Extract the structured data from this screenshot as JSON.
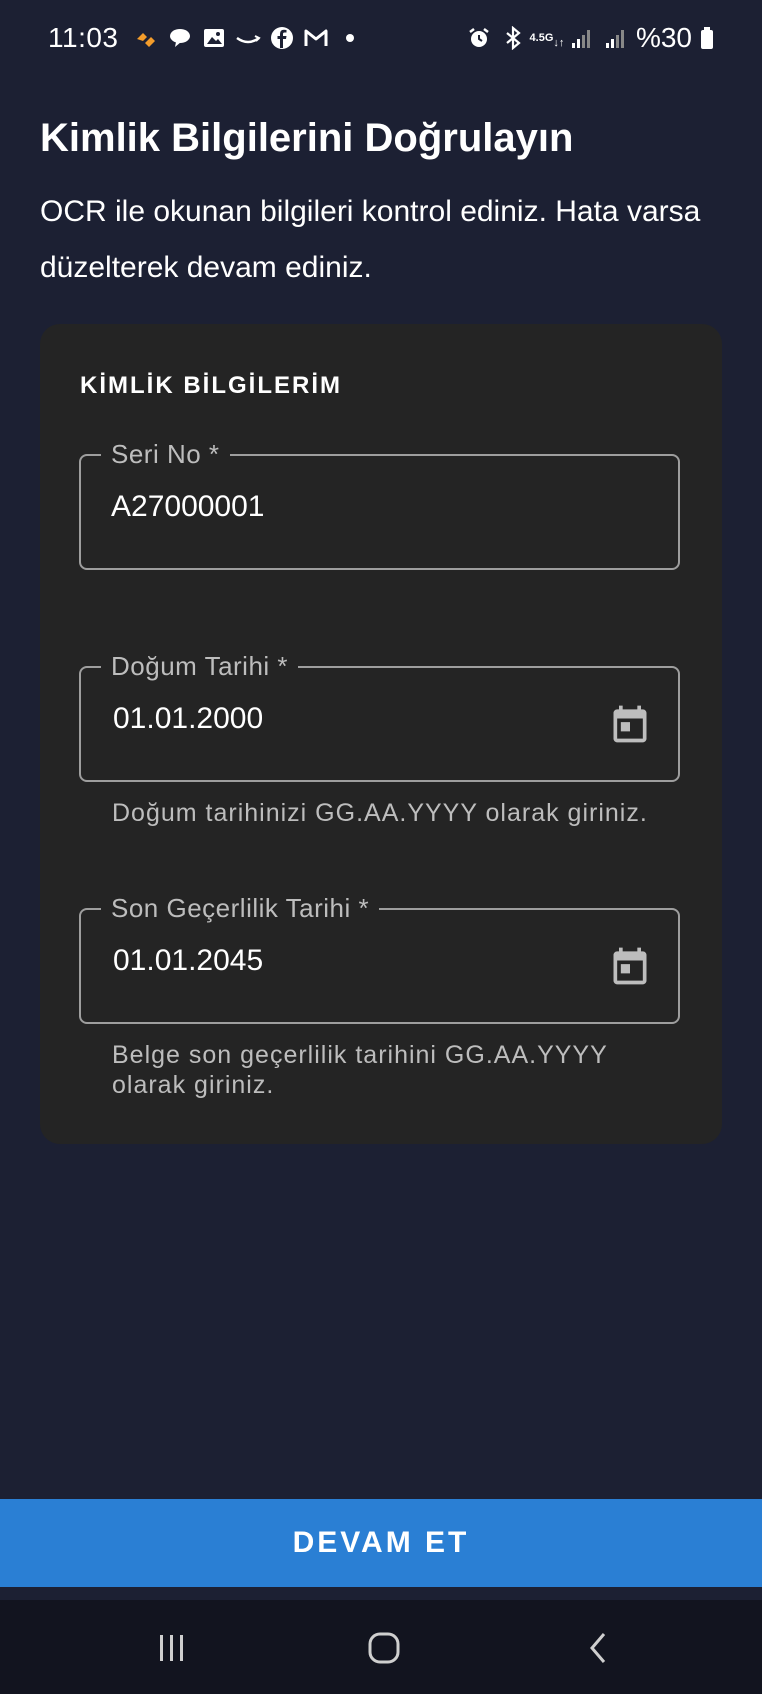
{
  "status_bar": {
    "time": "11:03",
    "battery": "%30",
    "network": "4.5G",
    "left_icons": [
      "activity-icon",
      "chat-icon",
      "gallery-icon",
      "amazon-icon",
      "facebook-icon",
      "gmail-icon",
      "dot-icon"
    ],
    "right_icons": [
      "alarm-icon",
      "bluetooth-icon",
      "network-icon",
      "signal-icon",
      "signal-icon",
      "battery-icon"
    ]
  },
  "header": {
    "title": "Kimlik Bilgilerini Doğrulayın",
    "subtitle": "OCR ile okunan bilgileri kontrol ediniz. Hata varsa düzelterek devam ediniz."
  },
  "card": {
    "title": "KİMLİK BİLGİLERİM",
    "fields": [
      {
        "label": "Seri No *",
        "value": "A27000001"
      },
      {
        "label": "Doğum Tarihi *",
        "value": "01.01.2000",
        "helper": "Doğum tarihinizi GG.AA.YYYY olarak giriniz."
      },
      {
        "label": "Son Geçerlilik Tarihi *",
        "value": "01.01.2045",
        "helper": "Belge son geçerlilik tarihini GG.AA.YYYY olarak giriniz."
      }
    ]
  },
  "continue_label": "DEVAM ET",
  "colors": {
    "background": "#1c2033",
    "card": "#242424",
    "accent": "#2a7fd4",
    "border": "#9e9e9e"
  }
}
